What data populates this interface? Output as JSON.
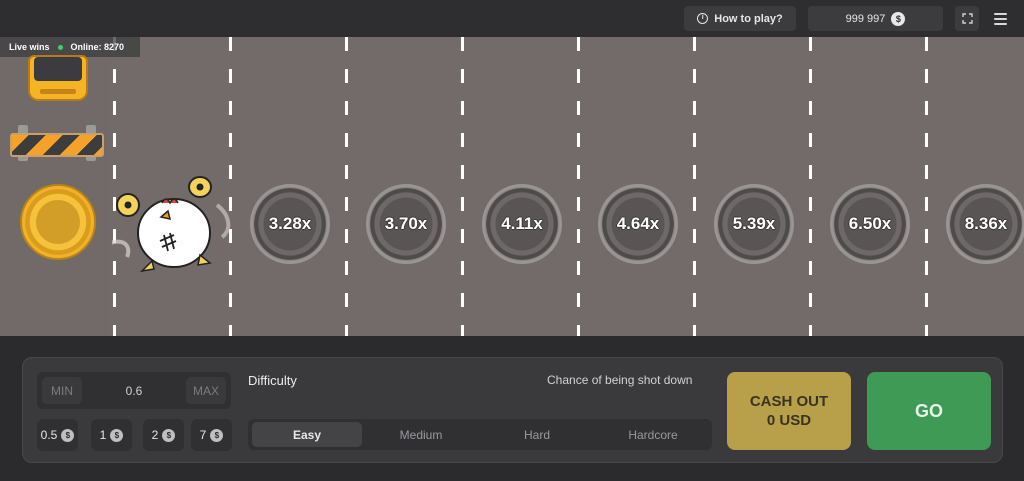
{
  "topbar": {
    "how_to_play": "How to play?",
    "balance": "999 997",
    "currency_symbol": "$"
  },
  "live": {
    "live_wins": "Live wins",
    "online": "Online: 8270"
  },
  "road": {
    "multipliers": [
      "3.28x",
      "3.70x",
      "4.11x",
      "4.64x",
      "5.39x",
      "6.50x",
      "8.36x"
    ]
  },
  "bet": {
    "min_label": "MIN",
    "value": "0.6",
    "max_label": "MAX",
    "quick_amounts": [
      "0.5",
      "1",
      "2",
      "7"
    ],
    "coin_symbol": "$"
  },
  "difficulty": {
    "label": "Difficulty",
    "chance_label": "Chance of being shot down",
    "options": [
      "Easy",
      "Medium",
      "Hard",
      "Hardcore"
    ],
    "selected": "Easy"
  },
  "actions": {
    "cashout_line1": "CASH OUT",
    "cashout_line2": "0 USD",
    "go": "GO"
  },
  "colors": {
    "road": "#726b6a",
    "cashout": "#b8a04a",
    "go": "#3e9a54"
  }
}
